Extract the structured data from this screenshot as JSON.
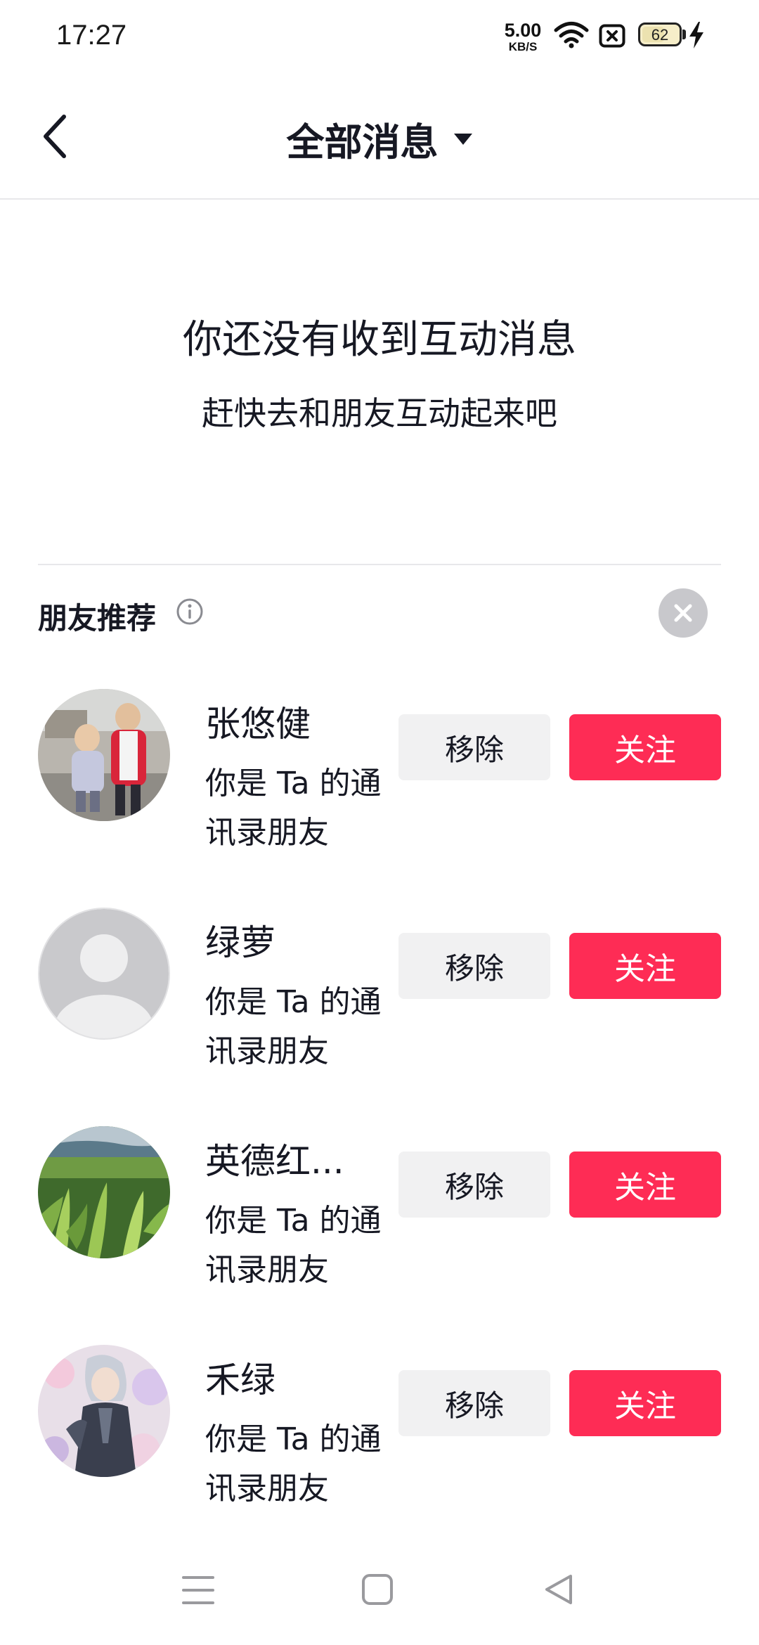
{
  "status_bar": {
    "time": "17:27",
    "net_speed_value": "5.00",
    "net_speed_unit": "KB/S",
    "battery_level": "62",
    "battery_fraction": 0.62,
    "icons": [
      "wifi-icon",
      "sim-no-signal-icon",
      "battery-icon",
      "charging-bolt-icon"
    ]
  },
  "header": {
    "title": "全部消息",
    "back_icon": "chevron-left-icon",
    "dropdown_icon": "caret-down-icon"
  },
  "empty_state": {
    "title": "你还没有收到互动消息",
    "subtitle": "赶快去和朋友互动起来吧"
  },
  "recommendations": {
    "title": "朋友推荐",
    "info_icon": "info-icon",
    "close_icon": "close-icon",
    "remove_label": "移除",
    "follow_label": "关注",
    "items": [
      {
        "name": "张悠健",
        "desc": "你是 Ta 的通讯录朋友",
        "avatar": "photo-children"
      },
      {
        "name": "绿萝",
        "desc": "你是 Ta 的通讯录朋友",
        "avatar": "default-avatar"
      },
      {
        "name": "英德红...",
        "desc": "你是 Ta 的通讯录朋友",
        "avatar": "photo-tea-field"
      },
      {
        "name": "禾绿",
        "desc": "你是 Ta 的通讯录朋友",
        "avatar": "illustration-character"
      }
    ]
  },
  "colors": {
    "accent": "#fe2c55",
    "secondary_button": "#f1f1f2",
    "text": "#161823",
    "divider": "#e8e8ea"
  },
  "nav_bar": {
    "icons": [
      "menu-icon",
      "home-square-icon",
      "back-triangle-icon"
    ]
  }
}
